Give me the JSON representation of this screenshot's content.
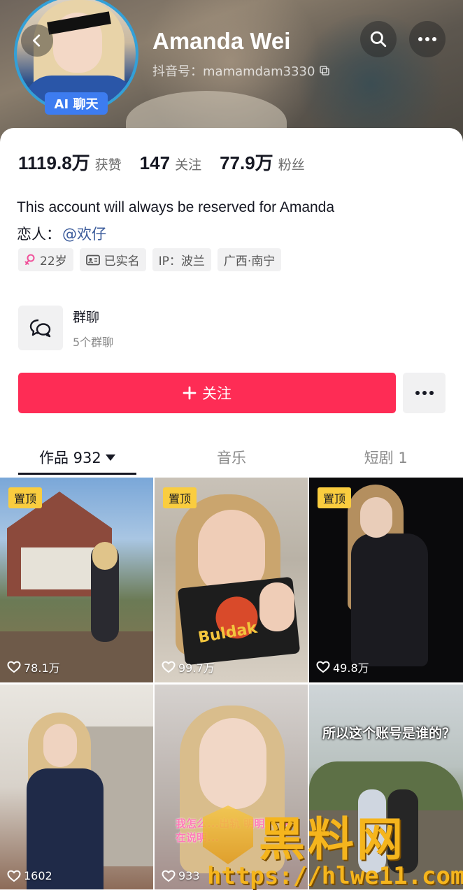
{
  "colors": {
    "accent": "#fe2c55",
    "pin": "#facd3f",
    "ai_badge": "#3d7cf0",
    "link": "#3b5b9b"
  },
  "header": {
    "name": "Amanda Wei",
    "douyin_id": "抖音号：mamamdam3330",
    "ai_badge": "AI 聊天",
    "back_icon": "chevron-left-icon",
    "search_icon": "search-icon",
    "more_icon": "more-horizontal-icon"
  },
  "stats": [
    {
      "value": "1119.8万",
      "label": "获赞"
    },
    {
      "value": "147",
      "label": "关注"
    },
    {
      "value": "77.9万",
      "label": "粉丝"
    }
  ],
  "bio": "This account will always be reserved for Amanda",
  "lover": {
    "label": "恋人：",
    "link": "@欢仔"
  },
  "tags": [
    {
      "icon": "gender-female-icon",
      "text": "22岁"
    },
    {
      "icon": "id-card-icon",
      "text": "已实名"
    },
    {
      "icon": "",
      "text": "IP：波兰"
    },
    {
      "icon": "",
      "text": "广西·南宁"
    }
  ],
  "group": {
    "title": "群聊",
    "subtitle": "5个群聊",
    "icon": "chat-bubbles-icon"
  },
  "follow_button": "关注",
  "tabs": [
    {
      "label": "作品 932",
      "active": true
    },
    {
      "label": "音乐",
      "active": false
    },
    {
      "label": "短剧 1",
      "active": false
    }
  ],
  "videos": [
    {
      "pinned": "置顶",
      "likes": "78.1万"
    },
    {
      "pinned": "置顶",
      "likes": "99.7万"
    },
    {
      "pinned": "置顶",
      "likes": "49.8万"
    },
    {
      "pinned": "",
      "likes": "1602"
    },
    {
      "pinned": "",
      "likes": "933"
    },
    {
      "pinned": "",
      "likes": "",
      "caption": "所以这个账号是谁的？"
    }
  ],
  "video_texts": {
    "pack_brand": "Buldak",
    "pink_overlay": "我怎么...出轨 明明... 这在说明..."
  },
  "watermark": {
    "text": "黑料网",
    "url": "https://hlwe11.com"
  }
}
